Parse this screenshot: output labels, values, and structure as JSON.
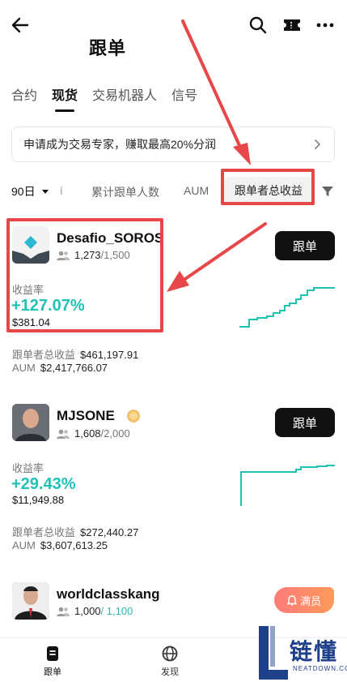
{
  "header": {
    "title": "跟单"
  },
  "tabs": [
    {
      "label": "合约",
      "active": false
    },
    {
      "label": "现货",
      "active": true
    },
    {
      "label": "交易机器人",
      "active": false
    },
    {
      "label": "信号",
      "active": false
    }
  ],
  "banner": {
    "text": "申请成为交易专家，赚取最高20%分润"
  },
  "sort_bar": {
    "period": "90日",
    "divider": "ⅰ",
    "followers": "累计跟单人数",
    "aum": "AUM",
    "profit": "跟单者总收益"
  },
  "traders": [
    {
      "name": "Desafio_SOROS",
      "followers": "1,273",
      "max": "/1,500",
      "button": "跟单",
      "roi_label": "收益率",
      "roi": "+127.07%",
      "pnl": "$381.04",
      "profit_label": "跟单者总收益",
      "profit": "$461,197.91",
      "aum_label": "AUM",
      "aum": "$2,417,766.07"
    },
    {
      "name": "MJSONE",
      "followers": "1,608",
      "max": "/2,000",
      "button": "跟单",
      "roi_label": "收益率",
      "roi": "+29.43%",
      "pnl": "$11,949.88",
      "profit_label": "跟单者总收益",
      "profit": "$272,440.27",
      "aum_label": "AUM",
      "aum": "$3,607,613.25"
    },
    {
      "name": "worldclasskang",
      "followers": "1,000",
      "max": "/ 1,100",
      "badge": "满员"
    }
  ],
  "bottom_nav": [
    {
      "label": "跟单",
      "icon": "document-icon"
    },
    {
      "label": "发现",
      "icon": "globe-icon"
    }
  ],
  "watermark": {
    "text": "链懂",
    "sub": "NEATDOWN.COM"
  },
  "colors": {
    "accent": "#21c2b6",
    "annotation": "#e8474a",
    "button": "#111111"
  }
}
